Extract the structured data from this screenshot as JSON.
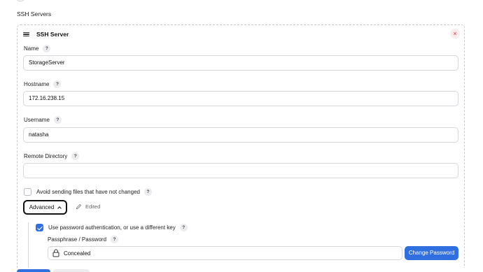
{
  "section": {
    "title": "SSH Servers"
  },
  "card": {
    "title": "SSH Server",
    "close_symbol": "×"
  },
  "fields": {
    "name": {
      "label": "Name",
      "value": "StorageServer"
    },
    "hostname": {
      "label": "Hostname",
      "value": "172.16.238.15"
    },
    "username": {
      "label": "Username",
      "value": "natasha"
    },
    "remote_directory": {
      "label": "Remote Directory",
      "value": ""
    }
  },
  "help_symbol": "?",
  "avoid_sending": {
    "label": "Avoid sending files that have not changed",
    "checked": false
  },
  "advanced": {
    "label": "Advanced",
    "edited_label": "Edited"
  },
  "password_auth": {
    "label": "Use password authentication, or use a different key",
    "checked": true
  },
  "passphrase": {
    "label": "Passphrase / Password",
    "value": "Concealed",
    "change_label": "Change Password"
  },
  "colors": {
    "accent": "#2f6fe0",
    "close": "#d33333"
  },
  "icons": [
    "hamburger-icon",
    "close-icon",
    "help-icon",
    "chevron-up-icon",
    "pencil-icon",
    "lock-icon",
    "checkmark-icon"
  ]
}
